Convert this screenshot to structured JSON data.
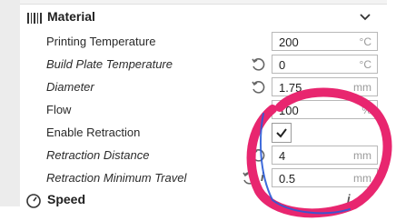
{
  "category": {
    "label": "Material",
    "icon": "material-icon",
    "chevron": "chevron-down-icon"
  },
  "settings": [
    {
      "label": "Printing Temperature",
      "value": "200",
      "unit": "°C",
      "italic": false
    },
    {
      "label": "Build Plate Temperature",
      "value": "0",
      "unit": "°C",
      "italic": true
    },
    {
      "label": "Diameter",
      "value": "1.75",
      "unit": "mm",
      "italic": true
    },
    {
      "label": "Flow",
      "value": "100",
      "unit": "%",
      "italic": false
    },
    {
      "label": "Enable Retraction",
      "checked": true,
      "italic": false
    },
    {
      "label": "Retraction Distance",
      "value": "4",
      "unit": "mm",
      "italic": true
    },
    {
      "label": "Retraction Minimum Travel",
      "value": "0.5",
      "unit": "mm",
      "italic": true
    }
  ],
  "next_category": {
    "label": "Speed",
    "icon": "speedometer-icon"
  },
  "colors": {
    "annotation": "#e8266f",
    "accent": "#2a5bd7"
  }
}
